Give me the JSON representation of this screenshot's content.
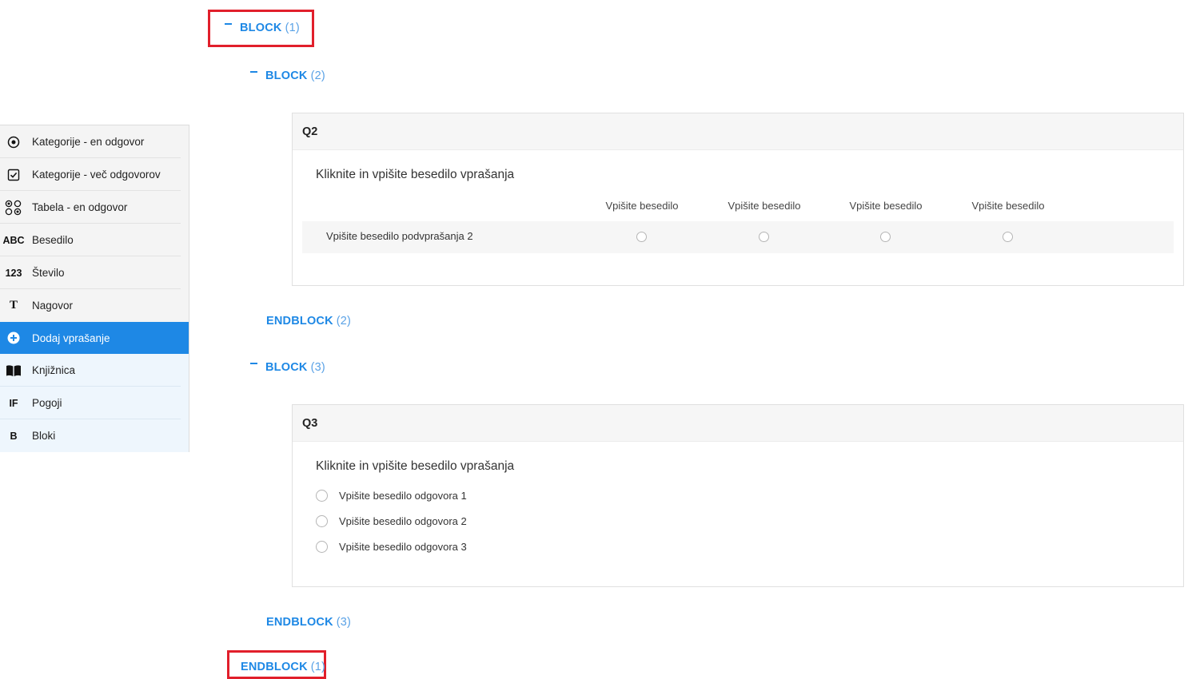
{
  "sidebar": {
    "items": [
      {
        "icon": "radio-circle-icon",
        "label": "Kategorije - en odgovor"
      },
      {
        "icon": "checkbox-icon",
        "label": "Kategorije - več odgovorov"
      },
      {
        "icon": "table-grid-icon",
        "label": "Tabela - en odgovor"
      },
      {
        "icon_text": "ABC",
        "label": "Besedilo"
      },
      {
        "icon_text": "123",
        "label": "Število"
      },
      {
        "icon_text": "T",
        "label": "Nagovor"
      },
      {
        "icon": "plus-circle-icon",
        "label": "Dodaj vprašanje"
      },
      {
        "icon": "book-icon",
        "label": "Knjižnica"
      },
      {
        "icon_text": "IF",
        "label": "Pogoji"
      },
      {
        "icon_text": "B",
        "label": "Bloki"
      }
    ]
  },
  "blocks": {
    "b1": {
      "label": "BLOCK",
      "num": "(1)"
    },
    "b2": {
      "label": "BLOCK",
      "num": "(2)"
    },
    "e2": {
      "label": "ENDBLOCK",
      "num": "(2)"
    },
    "b3": {
      "label": "BLOCK",
      "num": "(3)"
    },
    "e3": {
      "label": "ENDBLOCK",
      "num": "(3)"
    },
    "e1": {
      "label": "ENDBLOCK",
      "num": "(1)"
    }
  },
  "q2": {
    "id": "Q2",
    "text": "Kliknite in vpišite besedilo vprašanja",
    "columns": [
      "Vpišite besedilo",
      "Vpišite besedilo",
      "Vpišite besedilo",
      "Vpišite besedilo"
    ],
    "row_label": "Vpišite besedilo podvprašanja 2"
  },
  "q3": {
    "id": "Q3",
    "text": "Kliknite in vpišite besedilo vprašanja",
    "options": [
      "Vpišite besedilo odgovora 1",
      "Vpišite besedilo odgovora 2",
      "Vpišite besedilo odgovora 3"
    ]
  },
  "colors": {
    "accent": "#1e88e5",
    "highlight": "#e11f2b"
  }
}
